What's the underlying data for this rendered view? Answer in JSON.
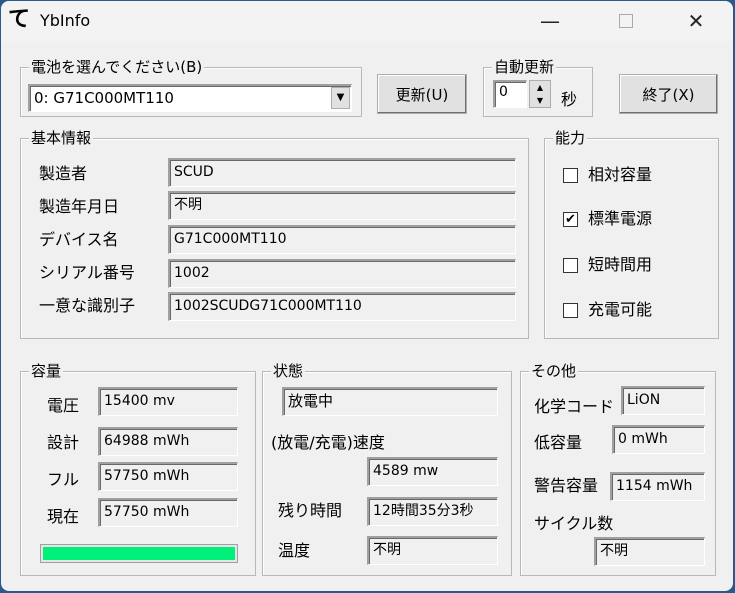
{
  "window": {
    "title": "YbInfo",
    "app_icon": "te-logo"
  },
  "battery_select": {
    "group_label": "電池を選んでください(B)",
    "selected": "0: G71C000MT110"
  },
  "refresh_button": "更新(U)",
  "auto_refresh": {
    "group_label": "自動更新",
    "value": "0",
    "unit": "秒"
  },
  "exit_button": "終了(X)",
  "basic_info": {
    "group_label": "基本情報",
    "rows": [
      {
        "label": "製造者",
        "value": "SCUD"
      },
      {
        "label": "製造年月日",
        "value": "不明"
      },
      {
        "label": "デバイス名",
        "value": "G71C000MT110"
      },
      {
        "label": "シリアル番号",
        "value": "1002"
      },
      {
        "label": "一意な識別子",
        "value": "1002SCUDG71C000MT110"
      }
    ]
  },
  "capabilities": {
    "group_label": "能力",
    "items": [
      {
        "label": "相対容量",
        "checked": false
      },
      {
        "label": "標準電源",
        "checked": true
      },
      {
        "label": "短時間用",
        "checked": false
      },
      {
        "label": "充電可能",
        "checked": false
      }
    ]
  },
  "capacity": {
    "group_label": "容量",
    "rows": [
      {
        "label": "電圧",
        "value": "15400 mv"
      },
      {
        "label": "設計",
        "value": "64988 mWh"
      },
      {
        "label": "フル",
        "value": "57750 mWh"
      },
      {
        "label": "現在",
        "value": "57750 mWh"
      }
    ],
    "charge_percent": 100,
    "bar_color": "#00f07a"
  },
  "status": {
    "group_label": "状態",
    "state": "放電中",
    "rate_label": "(放電/充電)速度",
    "rate": "4589 mw",
    "remaining_label": "残り時間",
    "remaining": "12時間35分3秒",
    "temp_label": "温度",
    "temp": "不明"
  },
  "other": {
    "group_label": "その他",
    "chem_label": "化学コード",
    "chem": "LiON",
    "low_label": "低容量",
    "low": "0 mWh",
    "warn_label": "警告容量",
    "warn": "1154 mWh",
    "cycle_label": "サイクル数",
    "cycle": "不明"
  }
}
